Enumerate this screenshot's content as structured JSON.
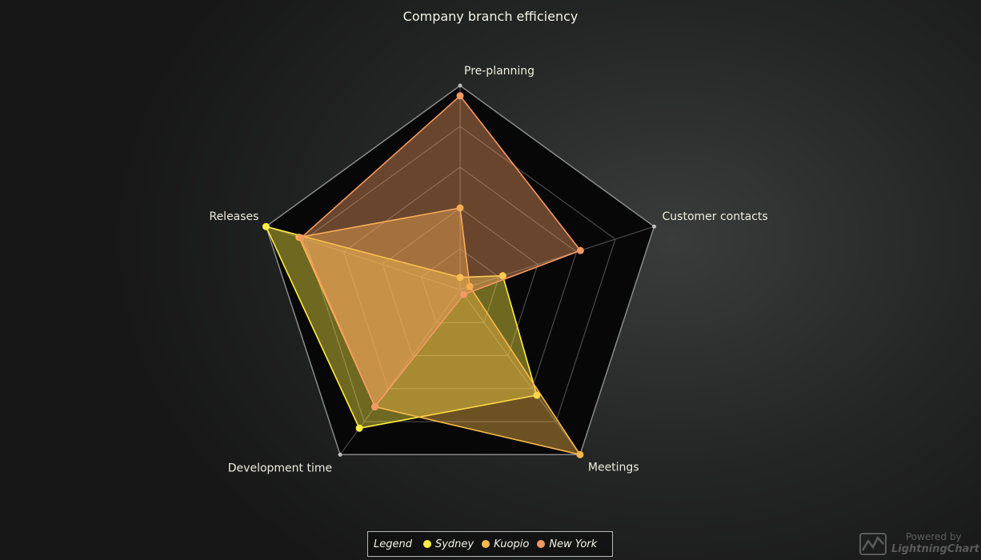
{
  "chart_data": {
    "type": "radar",
    "title": "Company branch efficiency",
    "axes": [
      "Pre-planning",
      "Customer contacts",
      "Meetings",
      "Development time",
      "Releases"
    ],
    "scale_max": 100,
    "rings": 5,
    "series": [
      {
        "name": "Sydney",
        "color": "#ffee44",
        "values": [
          6,
          22,
          64,
          84,
          100
        ]
      },
      {
        "name": "Kuopio",
        "color": "#f7b94a",
        "values": [
          40,
          5,
          100,
          71,
          83
        ]
      },
      {
        "name": "New York",
        "color": "#f39a64",
        "values": [
          95,
          62,
          3,
          71,
          82
        ]
      }
    ],
    "legend": {
      "title": "Legend",
      "position": "bottom-center"
    }
  },
  "watermark": {
    "line1": "Powered by",
    "line2": "LightningChart"
  }
}
